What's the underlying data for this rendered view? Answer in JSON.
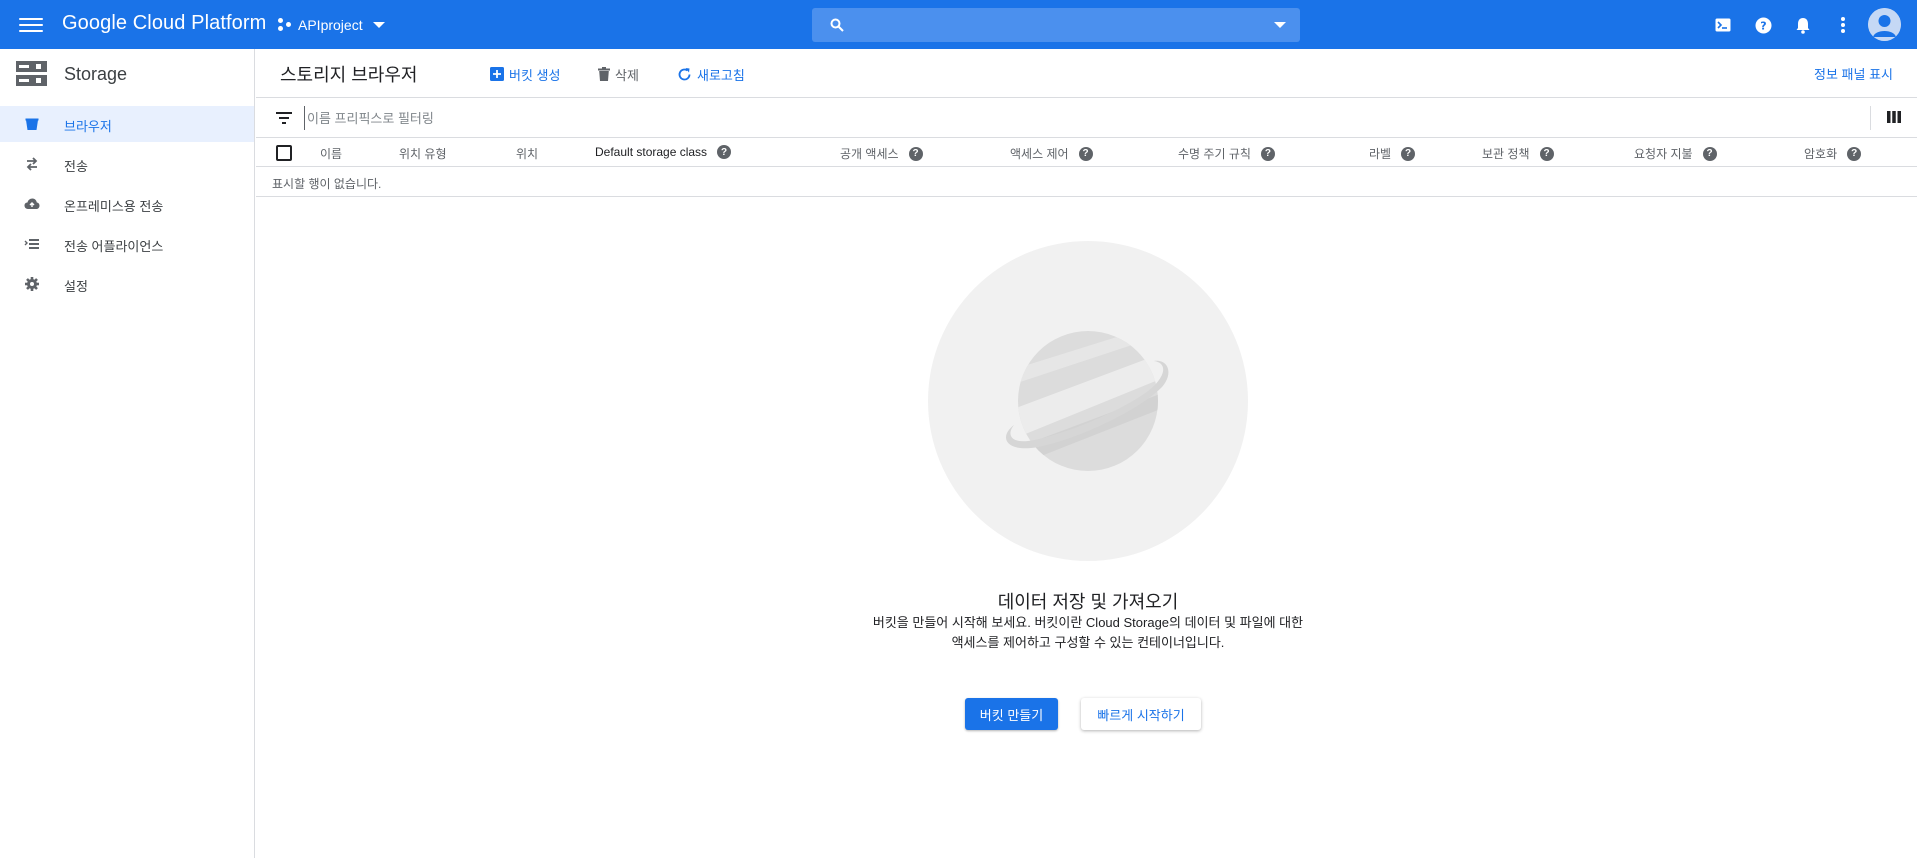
{
  "topbar": {
    "brand": "Google Cloud Platform",
    "project": "APIproject",
    "search_placeholder": ""
  },
  "icons": {
    "menu": "hamburger-menu-icon",
    "search": "search-icon",
    "cloud_shell": "cloud-shell-icon",
    "help": "help-icon",
    "notifications": "bell-icon",
    "more": "more-vert-icon",
    "account": "account-avatar-icon"
  },
  "sidebar": {
    "title": "Storage",
    "items": [
      {
        "label": "브라우저",
        "icon": "bucket-icon",
        "active": true
      },
      {
        "label": "전송",
        "icon": "swap-arrows-icon",
        "active": false
      },
      {
        "label": "온프레미스용 전송",
        "icon": "cloud-upload-icon",
        "active": false
      },
      {
        "label": "전송 어플라이언스",
        "icon": "list-icon",
        "active": false
      },
      {
        "label": "설정",
        "icon": "gear-icon",
        "active": false
      }
    ]
  },
  "actionbar": {
    "title": "스토리지 브라우저",
    "create_bucket": "버킷 생성",
    "delete": "삭제",
    "refresh": "새로고침",
    "info_panel": "정보 패널 표시"
  },
  "filter": {
    "placeholder": "이름 프리픽스로 필터링"
  },
  "table": {
    "columns": [
      {
        "label": "이름",
        "help": false
      },
      {
        "label": "위치 유형",
        "help": false
      },
      {
        "label": "위치",
        "help": false
      },
      {
        "label": "Default storage class",
        "help": true
      },
      {
        "label": "공개 액세스",
        "help": true
      },
      {
        "label": "액세스 제어",
        "help": true
      },
      {
        "label": "수명 주기 규칙",
        "help": true
      },
      {
        "label": "라벨",
        "help": true
      },
      {
        "label": "보관 정책",
        "help": true
      },
      {
        "label": "요청자 지불",
        "help": true
      },
      {
        "label": "암호화",
        "help": true
      }
    ],
    "empty_message": "표시할 행이 없습니다."
  },
  "empty_state": {
    "title": "데이터 저장 및 가져오기",
    "desc_line1": "버킷을 만들어 시작해 보세요. 버킷이란 Cloud Storage의 데이터 및 파일에 대한",
    "desc_line2": "액세스를 제어하고 구성할 수 있는 컨테이너입니다.",
    "primary_button": "버킷 만들기",
    "secondary_button": "빠르게 시작하기"
  },
  "colors": {
    "topbar": "#1a73e8",
    "accent": "#1a73e8",
    "sidebar_active": "#e8f0fe"
  }
}
